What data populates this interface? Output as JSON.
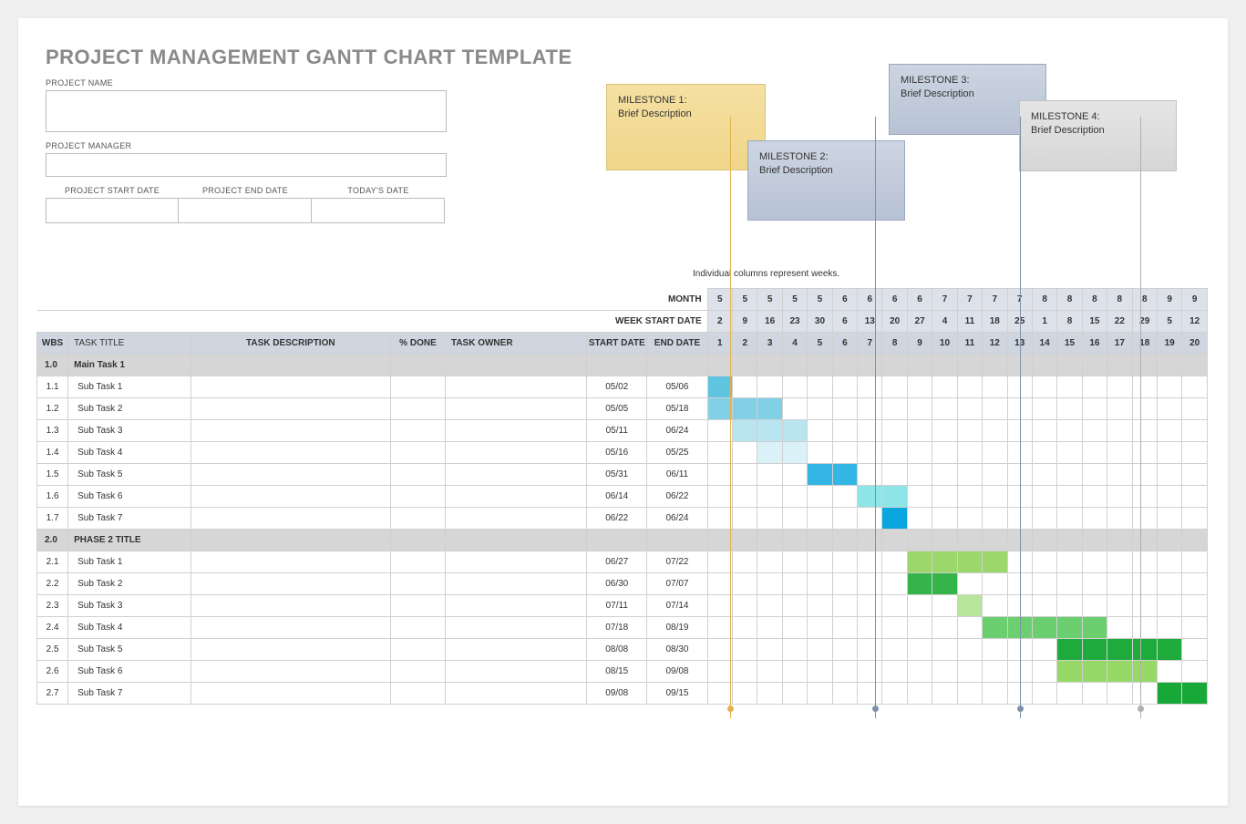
{
  "title": "PROJECT MANAGEMENT GANTT CHART TEMPLATE",
  "meta": {
    "project_name_label": "PROJECT NAME",
    "project_manager_label": "PROJECT MANAGER",
    "start_label": "PROJECT START DATE",
    "end_label": "PROJECT END DATE",
    "today_label": "TODAY'S DATE"
  },
  "milestones": [
    {
      "title": "MILESTONE 1:",
      "desc": "Brief Description"
    },
    {
      "title": "MILESTONE 2:",
      "desc": "Brief Description"
    },
    {
      "title": "MILESTONE 3:",
      "desc": "Brief Description"
    },
    {
      "title": "MILESTONE 4:",
      "desc": "Brief Description"
    }
  ],
  "weeks_note": "Individual columns represent weeks.",
  "row_labels": {
    "month": "MONTH",
    "week_start": "WEEK START DATE"
  },
  "col_headers": [
    "WBS",
    "TASK TITLE",
    "TASK DESCRIPTION",
    "% DONE",
    "TASK OWNER",
    "START DATE",
    "END DATE"
  ],
  "months": [
    "5",
    "5",
    "5",
    "5",
    "5",
    "6",
    "6",
    "6",
    "6",
    "7",
    "7",
    "7",
    "7",
    "8",
    "8",
    "8",
    "8",
    "8",
    "9",
    "9"
  ],
  "week_starts": [
    "2",
    "9",
    "16",
    "23",
    "30",
    "6",
    "13",
    "20",
    "27",
    "4",
    "11",
    "18",
    "25",
    "1",
    "8",
    "15",
    "22",
    "29",
    "5",
    "12"
  ],
  "week_nums": [
    "1",
    "2",
    "3",
    "4",
    "5",
    "6",
    "7",
    "8",
    "9",
    "10",
    "11",
    "12",
    "13",
    "14",
    "15",
    "16",
    "17",
    "18",
    "19",
    "20"
  ],
  "chart_data": {
    "type": "bar",
    "title": "Project Management Gantt Chart",
    "xlabel": "Week",
    "ylabel": "Task",
    "x_range": [
      1,
      20
    ],
    "series": [
      {
        "name": "Main Task 1",
        "wbs": "1.0",
        "phase": true
      },
      {
        "name": "Sub Task 1",
        "wbs": "1.1",
        "start": "05/02",
        "end": "05/06",
        "bar_start": 1,
        "bar_end": 1,
        "color": "cA"
      },
      {
        "name": "Sub Task 2",
        "wbs": "1.2",
        "start": "05/05",
        "end": "05/18",
        "bar_start": 1,
        "bar_end": 3,
        "color": "cB"
      },
      {
        "name": "Sub Task 3",
        "wbs": "1.3",
        "start": "05/11",
        "end": "06/24",
        "bar_start": 2,
        "bar_end": 4,
        "color": "cC"
      },
      {
        "name": "Sub Task 4",
        "wbs": "1.4",
        "start": "05/16",
        "end": "05/25",
        "bar_start": 3,
        "bar_end": 4,
        "color": "cD"
      },
      {
        "name": "Sub Task 5",
        "wbs": "1.5",
        "start": "05/31",
        "end": "06/11",
        "bar_start": 5,
        "bar_end": 6,
        "color": "cE"
      },
      {
        "name": "Sub Task 6",
        "wbs": "1.6",
        "start": "06/14",
        "end": "06/22",
        "bar_start": 7,
        "bar_end": 8,
        "color": "cF"
      },
      {
        "name": "Sub Task 7",
        "wbs": "1.7",
        "start": "06/22",
        "end": "06/24",
        "bar_start": 8,
        "bar_end": 8,
        "color": "cG"
      },
      {
        "name": "PHASE 2 TITLE",
        "wbs": "2.0",
        "phase": true
      },
      {
        "name": "Sub Task 1",
        "wbs": "2.1",
        "start": "06/27",
        "end": "07/22",
        "bar_start": 9,
        "bar_end": 12,
        "color": "gA"
      },
      {
        "name": "Sub Task 2",
        "wbs": "2.2",
        "start": "06/30",
        "end": "07/07",
        "bar_start": 9,
        "bar_end": 10,
        "color": "gB"
      },
      {
        "name": "Sub Task 3",
        "wbs": "2.3",
        "start": "07/11",
        "end": "07/14",
        "bar_start": 11,
        "bar_end": 11,
        "color": "gC"
      },
      {
        "name": "Sub Task 4",
        "wbs": "2.4",
        "start": "07/18",
        "end": "08/19",
        "bar_start": 12,
        "bar_end": 16,
        "color": "gD"
      },
      {
        "name": "Sub Task 5",
        "wbs": "2.5",
        "start": "08/08",
        "end": "08/30",
        "bar_start": 15,
        "bar_end": 19,
        "color": "gE"
      },
      {
        "name": "Sub Task 6",
        "wbs": "2.6",
        "start": "08/15",
        "end": "09/08",
        "bar_start": 15,
        "bar_end": 18,
        "color": "gF"
      },
      {
        "name": "Sub Task 7",
        "wbs": "2.7",
        "start": "09/08",
        "end": "09/15",
        "bar_start": 19,
        "bar_end": 20,
        "color": "gG"
      }
    ],
    "milestone_markers": [
      {
        "week": 2,
        "color": "#e0b24d"
      },
      {
        "week": 8,
        "color": "#8091ab"
      },
      {
        "week": 14,
        "color": "#8091ab"
      },
      {
        "week": 19,
        "color": "#b0b0b0"
      }
    ]
  }
}
